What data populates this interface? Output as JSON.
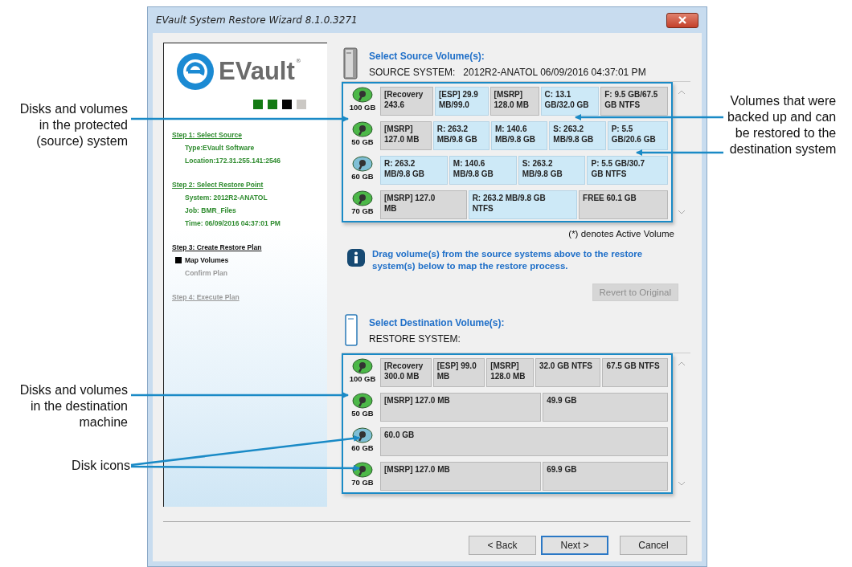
{
  "window": {
    "title": "EVault System Restore Wizard 8.1.0.3271"
  },
  "sidebar": {
    "logo_text": "EVault",
    "logo_mark": "®",
    "progress": [
      {
        "color": "#137a13"
      },
      {
        "color": "#137a13"
      },
      {
        "color": "#050505"
      },
      {
        "color": "#cbc8c4"
      }
    ],
    "steps": [
      {
        "title": "Step 1: Select Source",
        "done": true,
        "current": false,
        "items": [
          {
            "text": "Type:EVault Software",
            "done": true,
            "current": false
          },
          {
            "text": "Location:172.31.255.141:2546",
            "done": true,
            "current": false
          }
        ]
      },
      {
        "title": "Step 2: Select Restore Point",
        "done": true,
        "current": false,
        "items": [
          {
            "text": "System: 2012R2-ANATOL",
            "done": true,
            "current": false
          },
          {
            "text": "Job: BMR_Files",
            "done": true,
            "current": false
          },
          {
            "text": "Time: 06/09/2016 04:37:01 PM",
            "done": true,
            "current": false
          }
        ]
      },
      {
        "title": "Step 3: Create Restore Plan",
        "done": false,
        "current": true,
        "items": [
          {
            "text": "Map Volumes",
            "done": false,
            "current": true
          },
          {
            "text": "Confirm Plan",
            "done": false,
            "current": false
          }
        ]
      },
      {
        "title": "Step 4: Execute Plan",
        "done": false,
        "current": false
      }
    ]
  },
  "source": {
    "title": "Select Source Volume(s):",
    "system_label": "SOURCE SYSTEM:",
    "system_value": "2012R2-ANATOL 06/09/2016 04:37:01 PM",
    "disks": [
      {
        "size": "100 GB",
        "color": "#4cb848",
        "volumes": [
          {
            "text": "[Recovery\n243.6",
            "highlighted": false
          },
          {
            "text": "[ESP] 29.9\nMB/99.0",
            "highlighted": true
          },
          {
            "text": "[MSRP]\n128.0 MB",
            "highlighted": false
          },
          {
            "text": "C: 13.1\nGB/32.0 GB",
            "highlighted": true
          },
          {
            "text": "F: 9.5 GB/67.5\nGB NTFS",
            "highlighted": false
          }
        ]
      },
      {
        "size": "50 GB",
        "color": "#4cb848",
        "volumes": [
          {
            "text": "[MSRP]\n127.0 MB",
            "highlighted": false
          },
          {
            "text": "R: 263.2\nMB/9.8 GB",
            "highlighted": true
          },
          {
            "text": "M: 140.6\nMB/9.8 GB",
            "highlighted": true
          },
          {
            "text": "S: 263.2\nMB/9.8 GB",
            "highlighted": true
          },
          {
            "text": "P: 5.5\nGB/20.6 GB",
            "highlighted": true
          }
        ]
      },
      {
        "size": "60 GB",
        "color": "#7fbfd6",
        "volumes": [
          {
            "text": "R: 263.2\nMB/9.8 GB",
            "highlighted": true
          },
          {
            "text": "M: 140.6\nMB/9.8 GB",
            "highlighted": true
          },
          {
            "text": "S: 263.2\nMB/9.8 GB",
            "highlighted": true
          },
          {
            "text": "P: 5.5 GB/30.7\nGB NTFS",
            "highlighted": true
          }
        ]
      },
      {
        "size": "70 GB",
        "color": "#4cb848",
        "volumes": [
          {
            "text": "[MSRP] 127.0\nMB",
            "highlighted": false
          },
          {
            "text": "R: 263.2 MB/9.8 GB\nNTFS",
            "highlighted": true
          },
          {
            "text": "FREE 60.1 GB",
            "highlighted": false
          }
        ]
      }
    ]
  },
  "active_note": "(*) denotes Active Volume",
  "info": "Drag volume(s) from the source systems above to the restore system(s) below to map the restore process.",
  "revert_button": {
    "label": "Revert to Original",
    "disabled": true
  },
  "destination": {
    "title": "Select Destination Volume(s):",
    "system_label": "RESTORE SYSTEM:",
    "disks": [
      {
        "size": "100 GB",
        "color": "#4cb848",
        "volumes": [
          {
            "text": "[Recovery\n300.0 MB",
            "highlighted": false
          },
          {
            "text": "[ESP] 99.0\nMB",
            "highlighted": false
          },
          {
            "text": "[MSRP]\n128.0 MB",
            "highlighted": false
          },
          {
            "text": "32.0 GB NTFS",
            "highlighted": false
          },
          {
            "text": "67.5 GB NTFS",
            "highlighted": false
          }
        ]
      },
      {
        "size": "50 GB",
        "color": "#4cb848",
        "volumes": [
          {
            "text": "[MSRP] 127.0 MB",
            "highlighted": false
          },
          {
            "text": "49.9 GB",
            "highlighted": false
          }
        ]
      },
      {
        "size": "60 GB",
        "color": "#7fbfd6",
        "volumes": [
          {
            "text": "60.0 GB",
            "highlighted": false
          }
        ]
      },
      {
        "size": "70 GB",
        "color": "#4cb848",
        "volumes": [
          {
            "text": "[MSRP] 127.0 MB",
            "highlighted": false
          },
          {
            "text": "69.9 GB",
            "highlighted": false
          }
        ]
      }
    ]
  },
  "buttons": [
    {
      "label": "< Back",
      "default": false
    },
    {
      "label": "Next >",
      "default": true
    },
    {
      "label": "Cancel",
      "default": false
    }
  ],
  "callouts": [
    {
      "text": "Disks and volumes\nin the protected\n(source) system"
    },
    {
      "text": "Volumes that were\nbacked up and can\nbe restored to the\ndestination system"
    },
    {
      "text": "Disks and volumes\nin the destination\nmachine"
    },
    {
      "text": "Disk icons"
    }
  ]
}
